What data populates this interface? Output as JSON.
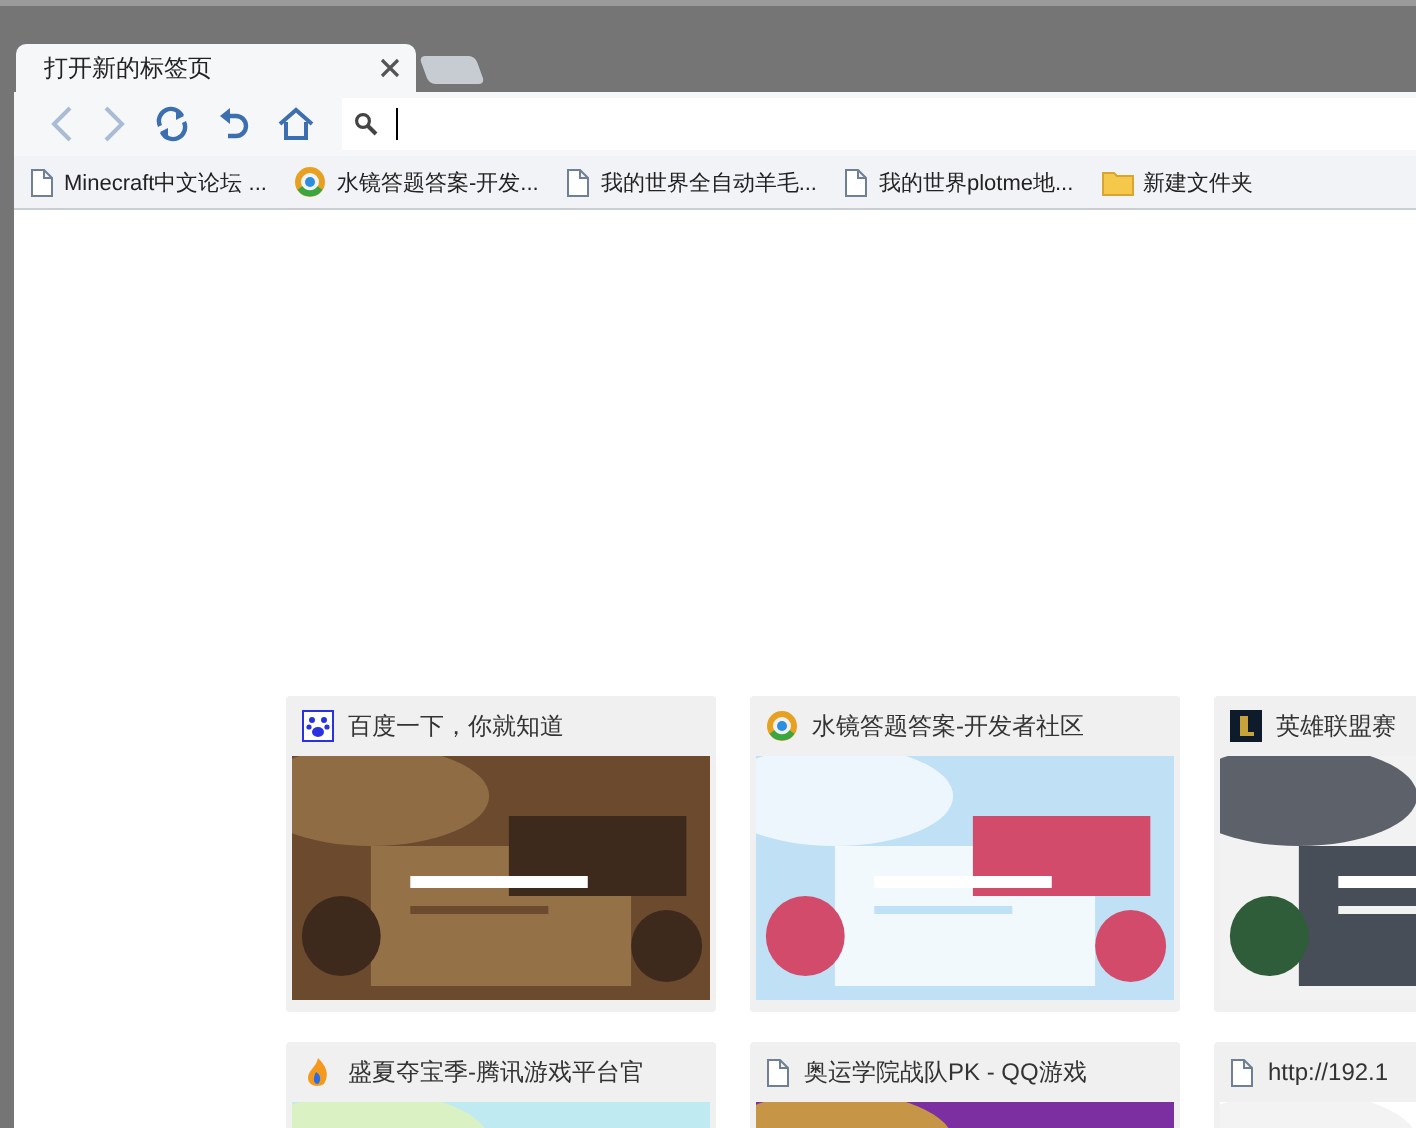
{
  "tabs": [
    {
      "title": "打开新的标签页",
      "selected": true
    }
  ],
  "bookmarks": [
    {
      "kind": "page",
      "label": "Minecraft中文论坛 ..."
    },
    {
      "kind": "ring",
      "label": "水镜答题答案-开发..."
    },
    {
      "kind": "page",
      "label": "我的世界全自动羊毛..."
    },
    {
      "kind": "page",
      "label": "我的世界plotme地..."
    },
    {
      "kind": "folder",
      "label": "新建文件夹"
    }
  ],
  "tiles": [
    {
      "kind": "paw",
      "title": "百度一下，你就知道"
    },
    {
      "kind": "ring",
      "title": "水镜答题答案-开发者社区"
    },
    {
      "kind": "shield",
      "title": "英雄联盟赛"
    },
    {
      "kind": "flame",
      "title": "盛夏夺宝季-腾讯游戏平台官"
    },
    {
      "kind": "page",
      "title": "奥运学院战队PK - QQ游戏"
    },
    {
      "kind": "page",
      "title": "http://192.1"
    }
  ]
}
